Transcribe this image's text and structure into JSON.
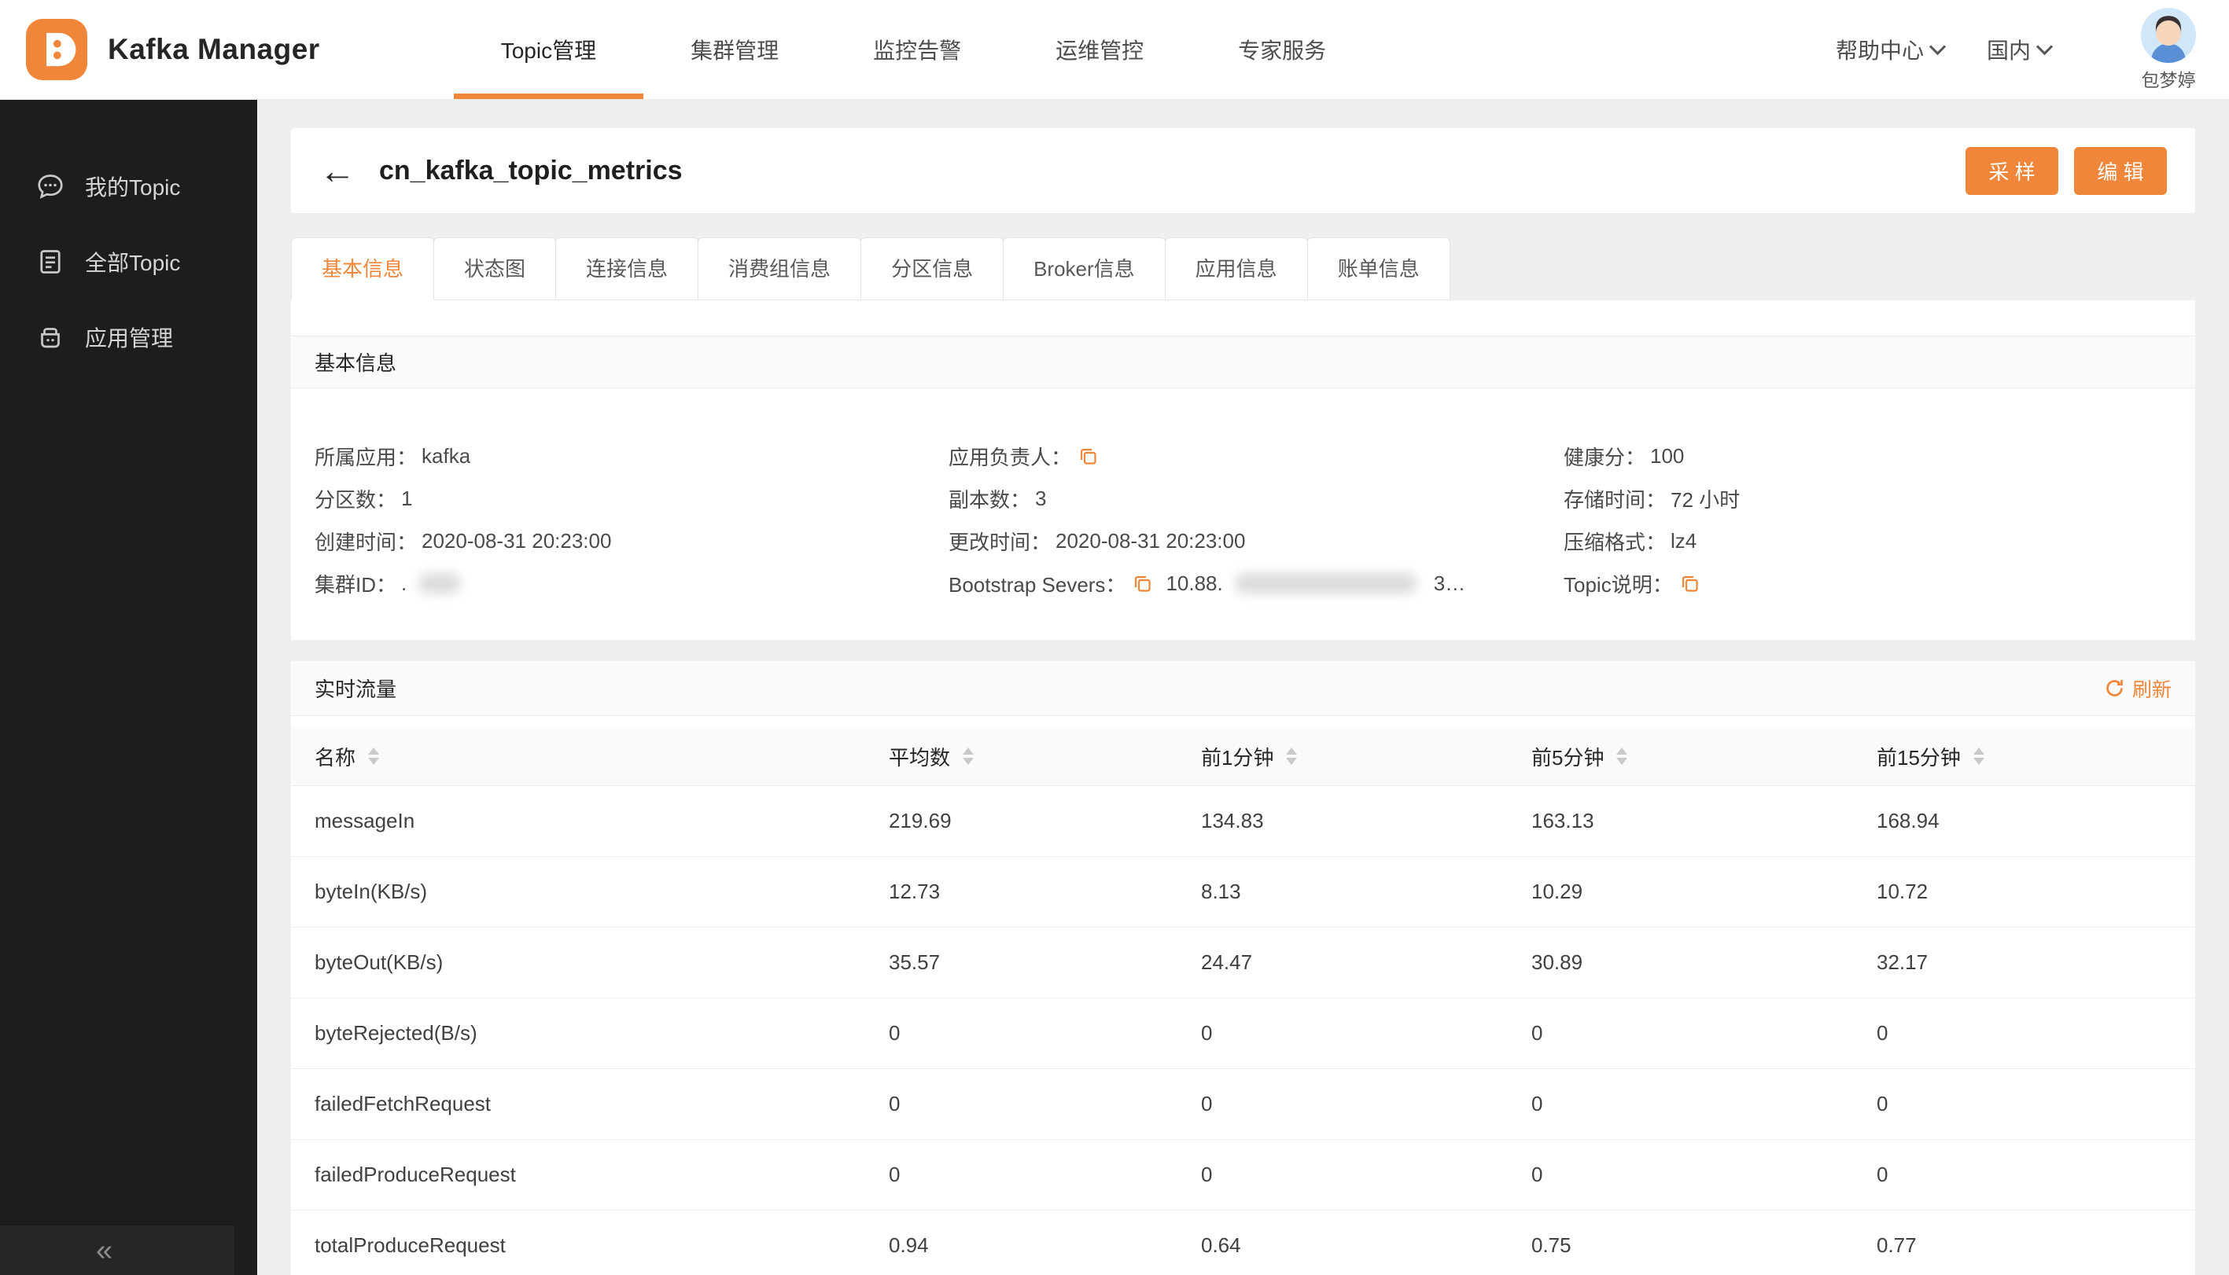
{
  "colors": {
    "accent": "#F0863A",
    "sidebar_bg": "#1D1D1D"
  },
  "navbar": {
    "brand": "Kafka Manager",
    "items": [
      {
        "label": "Topic管理",
        "active": true
      },
      {
        "label": "集群管理",
        "active": false
      },
      {
        "label": "监控告警",
        "active": false
      },
      {
        "label": "运维管控",
        "active": false
      },
      {
        "label": "专家服务",
        "active": false
      }
    ],
    "help": "帮助中心",
    "region": "国内",
    "user": "包梦婷"
  },
  "sidebar": {
    "items": [
      {
        "label": "我的Topic",
        "icon": "chat-icon"
      },
      {
        "label": "全部Topic",
        "icon": "doc-icon"
      },
      {
        "label": "应用管理",
        "icon": "app-icon"
      }
    ],
    "collapse": "«"
  },
  "page": {
    "back_icon": "←",
    "title": "cn_kafka_topic_metrics",
    "actions": {
      "sample": "采 样",
      "edit": "编 辑"
    }
  },
  "tabs": {
    "items": [
      "基本信息",
      "状态图",
      "连接信息",
      "消费组信息",
      "分区信息",
      "Broker信息",
      "应用信息",
      "账单信息"
    ],
    "active_index": 0
  },
  "basic_info": {
    "section_title": "基本信息",
    "fields": [
      {
        "label": "所属应用：",
        "value": "kafka"
      },
      {
        "label": "应用负责人：",
        "value": "",
        "copy": true
      },
      {
        "label": "健康分：",
        "value": "100"
      },
      {
        "label": "分区数：",
        "value": "1"
      },
      {
        "label": "副本数：",
        "value": "3"
      },
      {
        "label": "存储时间：",
        "value": "72 小时"
      },
      {
        "label": "创建时间：",
        "value": "2020-08-31 20:23:00"
      },
      {
        "label": "更改时间：",
        "value": "2020-08-31 20:23:00"
      },
      {
        "label": "压缩格式：",
        "value": "lz4"
      },
      {
        "label": "集群ID：",
        "value": ".",
        "redacted": "sm"
      },
      {
        "label": "Bootstrap Severs：",
        "value": "10.88.",
        "copy": true,
        "redacted": "lg",
        "value2": "3…"
      },
      {
        "label": "Topic说明：",
        "value": "",
        "copy": true
      }
    ]
  },
  "realtime": {
    "section_title": "实时流量",
    "refresh": "刷新",
    "table": {
      "columns": [
        "名称",
        "平均数",
        "前1分钟",
        "前5分钟",
        "前15分钟"
      ],
      "rows": [
        [
          "messageIn",
          "219.69",
          "134.83",
          "163.13",
          "168.94"
        ],
        [
          "byteIn(KB/s)",
          "12.73",
          "8.13",
          "10.29",
          "10.72"
        ],
        [
          "byteOut(KB/s)",
          "35.57",
          "24.47",
          "30.89",
          "32.17"
        ],
        [
          "byteRejected(B/s)",
          "0",
          "0",
          "0",
          "0"
        ],
        [
          "failedFetchRequest",
          "0",
          "0",
          "0",
          "0"
        ],
        [
          "failedProduceRequest",
          "0",
          "0",
          "0",
          "0"
        ],
        [
          "totalProduceRequest",
          "0.94",
          "0.64",
          "0.75",
          "0.77"
        ]
      ]
    }
  }
}
